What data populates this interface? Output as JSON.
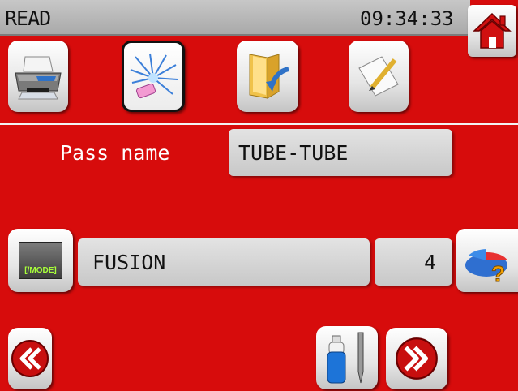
{
  "status": {
    "mode": "READ",
    "time": "09:34:33"
  },
  "icons": {
    "home": "home-icon",
    "printer": "printer-icon",
    "welding": "welding-spark-icon",
    "import": "folder-import-icon",
    "edit": "notepad-edit-icon",
    "mode": "mode-icon",
    "help": "help-chart-icon",
    "prev": "double-chevron-left-icon",
    "next": "double-chevron-right-icon",
    "gas": "gas-electrode-icon"
  },
  "pass": {
    "label": "Pass name",
    "value": "TUBE-TUBE"
  },
  "mode_row": {
    "mode_button_text": "[/MODE]",
    "mode_value": "FUSION",
    "number": "4"
  },
  "colors": {
    "background": "#d70c0c",
    "home": "#d01010",
    "help": "#e89a00"
  }
}
